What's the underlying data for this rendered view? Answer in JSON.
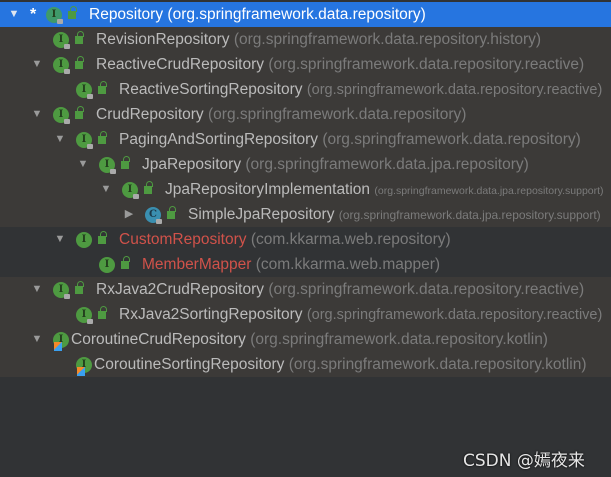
{
  "tree": [
    {
      "name": "Repository",
      "pkg": "(org.springframework.data.repository)",
      "level": 0,
      "arrow": "down",
      "selected": true,
      "star": "*",
      "kind": "interface",
      "lock": true
    },
    {
      "name": "RevisionRepository",
      "pkg": "(org.springframework.data.repository.history)",
      "level": 1,
      "arrow": null,
      "kind": "interface",
      "lock": true
    },
    {
      "name": "ReactiveCrudRepository",
      "pkg": "(org.springframework.data.repository.reactive)",
      "level": 1,
      "arrow": "down",
      "kind": "interface",
      "lock": true
    },
    {
      "name": "ReactiveSortingRepository",
      "pkg": "(org.springframework.data.repository.reactive)",
      "level": 2,
      "arrow": null,
      "kind": "interface",
      "lock": true
    },
    {
      "name": "CrudRepository",
      "pkg": "(org.springframework.data.repository)",
      "level": 1,
      "arrow": "down",
      "kind": "interface",
      "lock": true
    },
    {
      "name": "PagingAndSortingRepository",
      "pkg": "(org.springframework.data.repository)",
      "level": 2,
      "arrow": "down",
      "kind": "interface",
      "lock": true
    },
    {
      "name": "JpaRepository",
      "pkg": "(org.springframework.data.jpa.repository)",
      "level": 3,
      "arrow": "down",
      "kind": "interface",
      "lock": true
    },
    {
      "name": "JpaRepositoryImplementation",
      "pkg": "(org.springframework.data.jpa.repository.support)",
      "level": 4,
      "arrow": "down",
      "kind": "interface",
      "lock": true
    },
    {
      "name": "SimpleJpaRepository",
      "pkg": "(org.springframework.data.jpa.repository.support)",
      "level": 5,
      "arrow": "right",
      "kind": "class",
      "lock": true
    },
    {
      "name": "CustomRepository",
      "pkg": "(com.kkarma.web.repository)",
      "level": 2,
      "arrow": "down",
      "kind": "interface",
      "lock": false,
      "red": true,
      "dark": true
    },
    {
      "name": "MemberMapper",
      "pkg": "(com.kkarma.web.mapper)",
      "level": 3,
      "arrow": null,
      "kind": "interface",
      "lock": false,
      "red": true,
      "dark": true
    },
    {
      "name": "RxJava2CrudRepository",
      "pkg": "(org.springframework.data.repository.reactive)",
      "level": 1,
      "arrow": "down",
      "kind": "interface",
      "lock": true
    },
    {
      "name": "RxJava2SortingRepository",
      "pkg": "(org.springframework.data.repository.reactive)",
      "level": 2,
      "arrow": null,
      "kind": "interface",
      "lock": true
    },
    {
      "name": "CoroutineCrudRepository",
      "pkg": "(org.springframework.data.repository.kotlin)",
      "level": 1,
      "arrow": "down",
      "kind": "kotlin"
    },
    {
      "name": "CoroutineSortingRepository",
      "pkg": "(org.springframework.data.repository.kotlin)",
      "level": 2,
      "arrow": null,
      "kind": "kotlin"
    }
  ],
  "watermark": "CSDN @嫣夜来"
}
